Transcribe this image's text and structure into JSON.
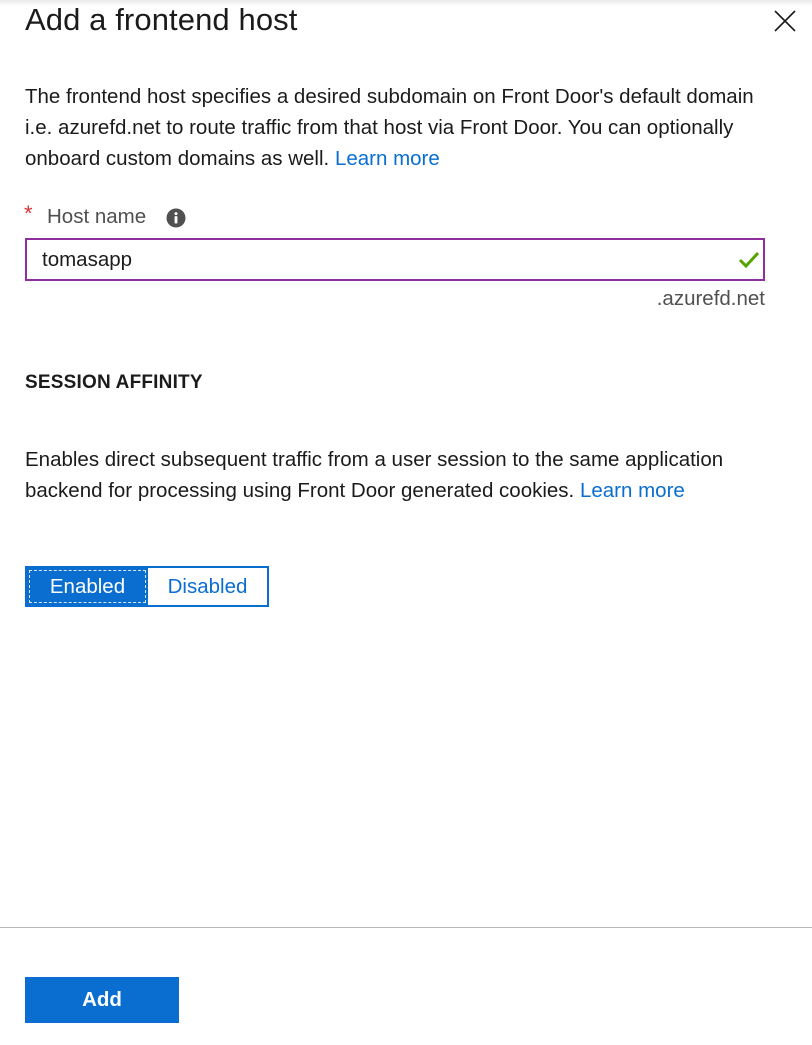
{
  "dialog": {
    "title": "Add a frontend host",
    "close_icon": "close-icon"
  },
  "intro": {
    "text": "The frontend host specifies a desired subdomain on Front Door's default domain i.e. azurefd.net to route traffic from that host via Front Door. You can optionally onboard custom domains as well.",
    "link_label": "Learn more"
  },
  "host_name": {
    "required_marker": "*",
    "label": "Host name",
    "info_icon": "info-icon",
    "value": "tomasapp",
    "valid_icon": "checkmark-icon",
    "suffix": ".azurefd.net"
  },
  "session_affinity": {
    "heading": "SESSION AFFINITY",
    "description": "Enables direct subsequent traffic from a user session to the same application backend for processing using Front Door generated cookies.",
    "link_label": "Learn more",
    "options": [
      "Enabled",
      "Disabled"
    ],
    "selected": "Enabled"
  },
  "footer": {
    "add_label": "Add"
  },
  "colors": {
    "accent": "#0a6ed1",
    "input_border": "#8d2f9c",
    "required": "#d13438",
    "valid": "#57a300"
  }
}
